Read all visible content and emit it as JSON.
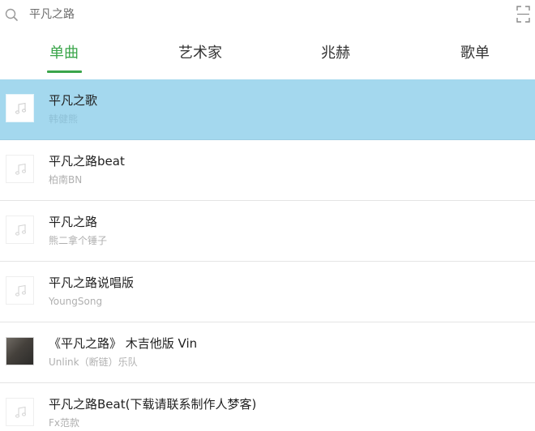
{
  "search": {
    "query": "平凡之路",
    "icons": {
      "search": "search-icon",
      "scan": "scan-icon"
    }
  },
  "tabs": [
    {
      "label": "单曲",
      "active": true
    },
    {
      "label": "艺术家",
      "active": false
    },
    {
      "label": "兆赫",
      "active": false
    },
    {
      "label": "歌单",
      "active": false
    }
  ],
  "colors": {
    "accent": "#3aa54a",
    "selected_row": "#a4d8ee"
  },
  "songs": [
    {
      "title": "平凡之歌",
      "artist": "韩健熊",
      "selected": true,
      "thumb": "music-note-icon"
    },
    {
      "title": "平凡之路beat",
      "artist": "柏南BN",
      "selected": false,
      "thumb": "music-note-icon"
    },
    {
      "title": "平凡之路",
      "artist": "熊二拿个锤子",
      "selected": false,
      "thumb": "music-note-icon"
    },
    {
      "title": "平凡之路说唱版",
      "artist": "YoungSong",
      "selected": false,
      "thumb": "music-note-icon"
    },
    {
      "title": "《平凡之路》 木吉他版 Vin",
      "artist": "Unlink（断链）乐队",
      "selected": false,
      "thumb": "album-cover"
    },
    {
      "title": "平凡之路Beat(下载请联系制作人梦客)",
      "artist": "Fx范款",
      "selected": false,
      "thumb": "music-note-icon"
    }
  ]
}
